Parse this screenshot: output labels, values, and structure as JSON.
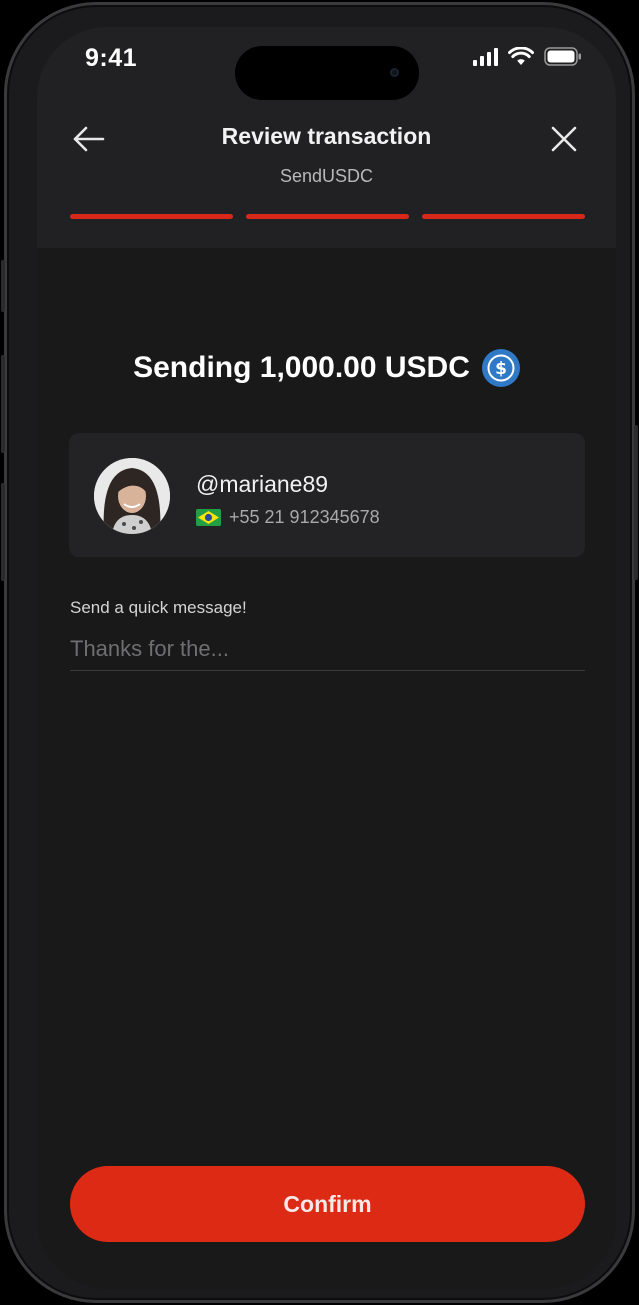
{
  "status_bar": {
    "time": "9:41"
  },
  "header": {
    "title": "Review transaction",
    "subtitle": "SendUSDC",
    "progress_steps_total": 3,
    "progress_steps_completed": 3,
    "back_icon": "arrow-left-icon",
    "close_icon": "close-icon"
  },
  "summary": {
    "text": "Sending 1,000.00 USDC",
    "token_icon": "usdc-icon"
  },
  "recipient": {
    "handle": "@mariane89",
    "country_flag": "brazil-flag-icon",
    "phone": "+55 21 912345678"
  },
  "message": {
    "label": "Send a quick message!",
    "placeholder": "Thanks for the...",
    "value": ""
  },
  "actions": {
    "confirm_label": "Confirm"
  },
  "colors": {
    "accent": "#dd2a14",
    "progress": "#d8281a",
    "background": "#19191a",
    "header_background": "#212123",
    "card_background": "#232325",
    "usdc_blue": "#2f79c6"
  }
}
